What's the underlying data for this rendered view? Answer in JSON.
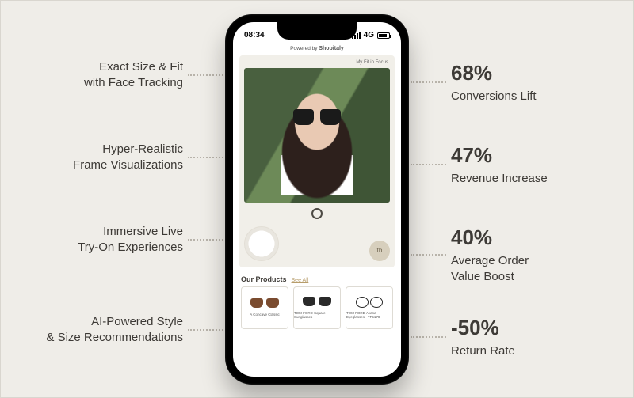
{
  "left_features": [
    {
      "line1": "Exact Size & Fit",
      "line2": "with Face Tracking"
    },
    {
      "line1": "Hyper-Realistic",
      "line2": "Frame Visualizations"
    },
    {
      "line1": "Immersive Live",
      "line2": "Try-On Experiences"
    },
    {
      "line1": "AI-Powered Style",
      "line2": "& Size Recommendations"
    }
  ],
  "right_stats": [
    {
      "value": "68%",
      "label": "Conversions Lift"
    },
    {
      "value": "47%",
      "label": "Revenue Increase"
    },
    {
      "value": "40%",
      "label1": "Average Order",
      "label2": "Value Boost"
    },
    {
      "value": "-50%",
      "label": "Return Rate"
    }
  ],
  "phone": {
    "time": "08:34",
    "network_label": "4G",
    "powered_by": "Powered by",
    "powered_brand": "Shopitaly",
    "tryon_tab": "My Fit in Focus",
    "thumb_btn": "tb",
    "our_products": "Our Products",
    "see_all": "See All",
    "cards": [
      {
        "name": "A Concave Classic"
      },
      {
        "name": "TOM FORD Square Sunglasses"
      },
      {
        "name": "TOM FORD Avana Eyeglasses · TF5178"
      }
    ]
  }
}
